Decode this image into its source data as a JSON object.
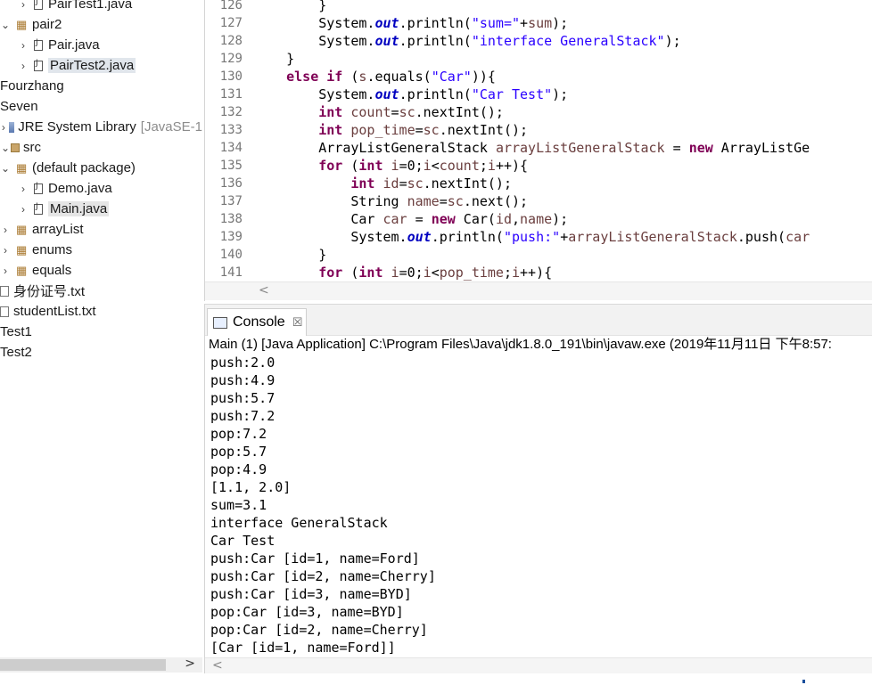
{
  "explorer": {
    "items": [
      {
        "label": "PairTest1.java",
        "type": "file",
        "indent": 2,
        "chevron": ">"
      },
      {
        "label": "pair2",
        "type": "package",
        "indent": 1,
        "chevron": "v"
      },
      {
        "label": "Pair.java",
        "type": "file",
        "indent": 2,
        "chevron": ">"
      },
      {
        "label": "PairTest2.java",
        "type": "file",
        "indent": 2,
        "chevron": ">",
        "highlight": true
      },
      {
        "label": "Fourzhang",
        "type": "project",
        "indent": 0,
        "chevron": ""
      },
      {
        "label": "Seven",
        "type": "project",
        "indent": 0,
        "chevron": ""
      },
      {
        "label": "JRE System Library",
        "suffix": "[JavaSE-1",
        "type": "library",
        "indent": 0,
        "chevron": ">"
      },
      {
        "label": "src",
        "type": "source",
        "indent": 0,
        "chevron": "v"
      },
      {
        "label": "(default package)",
        "type": "package",
        "indent": 1,
        "chevron": "v"
      },
      {
        "label": "Demo.java",
        "type": "file",
        "indent": 2,
        "chevron": ">"
      },
      {
        "label": "Main.java",
        "type": "file",
        "indent": 2,
        "chevron": ">",
        "selected": true
      },
      {
        "label": "arrayList",
        "type": "package",
        "indent": 1,
        "chevron": ">"
      },
      {
        "label": "enums",
        "type": "package",
        "indent": 1,
        "chevron": ">"
      },
      {
        "label": "equals",
        "type": "package",
        "indent": 1,
        "chevron": ">"
      },
      {
        "label": "身份证号.txt",
        "type": "txt",
        "indent": 0,
        "chevron": ""
      },
      {
        "label": "studentList.txt",
        "type": "txt",
        "indent": 0,
        "chevron": ""
      },
      {
        "label": "Test1",
        "type": "project",
        "indent": 0,
        "chevron": ""
      },
      {
        "label": "Test2",
        "type": "project",
        "indent": 0,
        "chevron": ""
      }
    ],
    "scroll_right_arrow": ">"
  },
  "editor": {
    "lines": [
      {
        "no": "126",
        "text": "        }"
      },
      {
        "no": "127",
        "text": "        System.out.println(\"sum=\"+sum);"
      },
      {
        "no": "128",
        "text": "        System.out.println(\"interface GeneralStack\");"
      },
      {
        "no": "129",
        "text": "    }"
      },
      {
        "no": "130",
        "text": "    else if (s.equals(\"Car\")){"
      },
      {
        "no": "131",
        "text": "        System.out.println(\"Car Test\");"
      },
      {
        "no": "132",
        "text": "        int count=sc.nextInt();"
      },
      {
        "no": "133",
        "text": "        int pop_time=sc.nextInt();"
      },
      {
        "no": "134",
        "text": "        ArrayListGeneralStack arrayListGeneralStack = new ArrayListGe"
      },
      {
        "no": "135",
        "text": "        for (int i=0;i<count;i++){"
      },
      {
        "no": "136",
        "text": "            int id=sc.nextInt();"
      },
      {
        "no": "137",
        "text": "            String name=sc.next();"
      },
      {
        "no": "138",
        "text": "            Car car = new Car(id,name);"
      },
      {
        "no": "139",
        "text": "            System.out.println(\"push:\"+arrayListGeneralStack.push(car"
      },
      {
        "no": "140",
        "text": "        }"
      },
      {
        "no": "141",
        "text": "        for (int i=0;i<pop_time;i++){"
      }
    ],
    "scroll_left_arrow": "<"
  },
  "console": {
    "tab_label": "Console",
    "tab_close": "☒",
    "header": "Main (1) [Java Application] C:\\Program Files\\Java\\jdk1.8.0_191\\bin\\javaw.exe (2019年11月11日 下午8:57:",
    "output": [
      "push:2.0",
      "push:4.9",
      "push:5.7",
      "push:7.2",
      "pop:7.2",
      "pop:5.7",
      "pop:4.9",
      "[1.1, 2.0]",
      "sum=3.1",
      "interface GeneralStack",
      "Car Test",
      "push:Car [id=1, name=Ford]",
      "push:Car [id=2, name=Cherry]",
      "push:Car [id=3, name=BYD]",
      "pop:Car [id=3, name=BYD]",
      "pop:Car [id=2, name=Cherry]",
      "[Car [id=1, name=Ford]]"
    ],
    "scroll_left_arrow": "<"
  },
  "colors": {
    "keyword": "#7f0055",
    "string": "#2a00ff",
    "static_field": "#0000c0",
    "selection": "#e5e5e5"
  }
}
